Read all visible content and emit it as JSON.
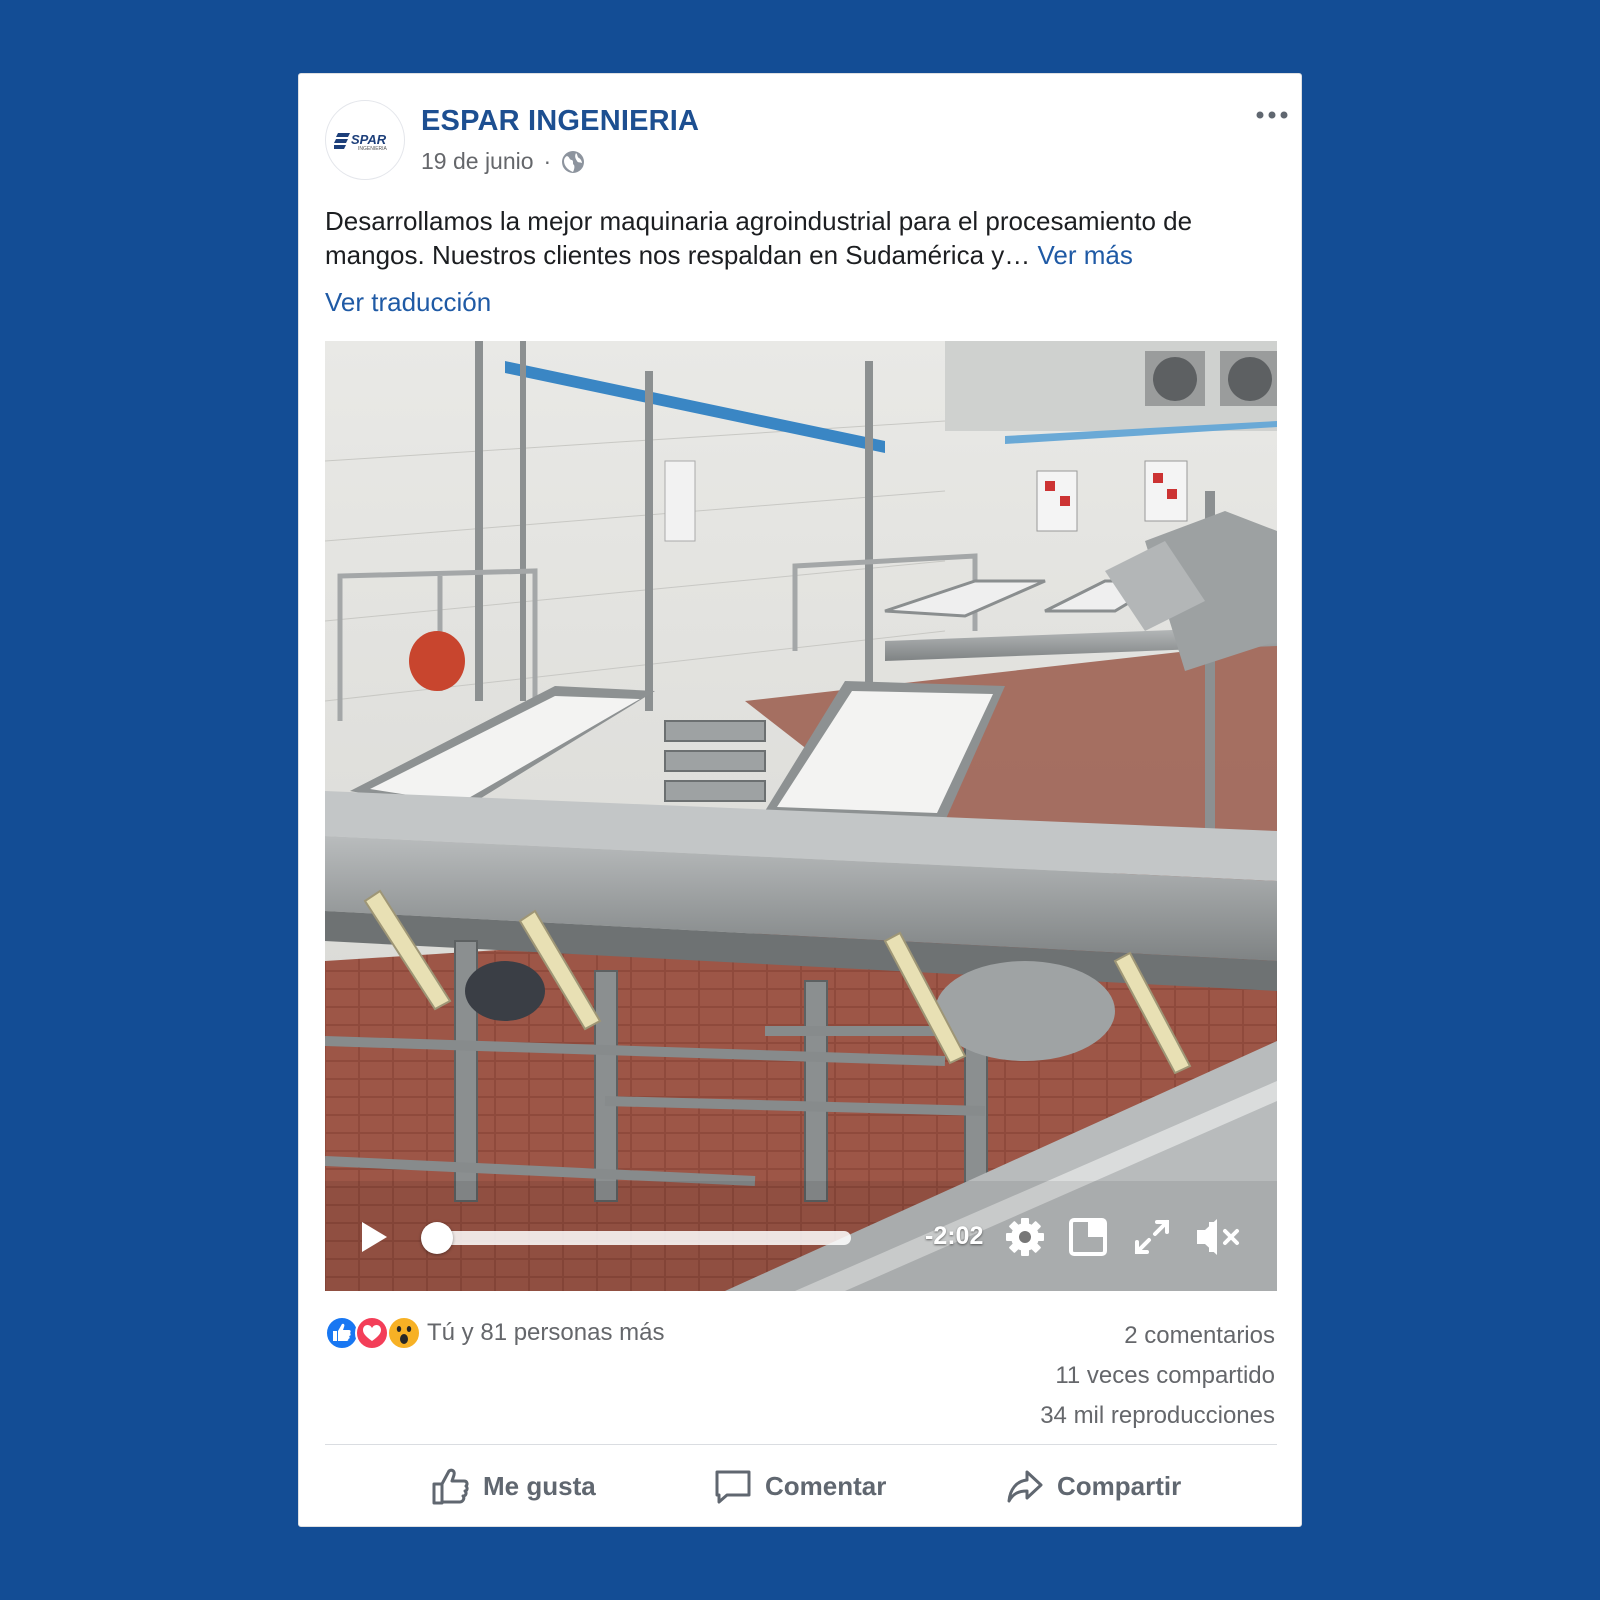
{
  "post": {
    "page_name": "ESPAR INGENIERIA",
    "logo_text": "SPAR",
    "logo_subtext": "INGENIERIA",
    "date": "19 de junio",
    "separator": "·",
    "text": "Desarrollamos la mejor maquinaria agroindustrial para el procesamiento de mangos. Nuestros clientes nos respaldan en Sudamérica y…",
    "see_more": "Ver más",
    "translate": "Ver traducción"
  },
  "video": {
    "time_remaining": "-2:02",
    "progress": 0.0,
    "muted": true
  },
  "engagement": {
    "reactions_text": "Tú y 81 personas más",
    "comments": "2 comentarios",
    "shares": "11 veces compartido",
    "views": "34 mil reproducciones"
  },
  "actions": {
    "like": "Me gusta",
    "comment": "Comentar",
    "share": "Compartir"
  },
  "colors": {
    "background": "#134d95",
    "page_name": "#1d4f91",
    "link": "#1f5aa5",
    "like_blue": "#1877f2",
    "love_red": "#f33e58",
    "wow_yellow": "#f7b125"
  }
}
